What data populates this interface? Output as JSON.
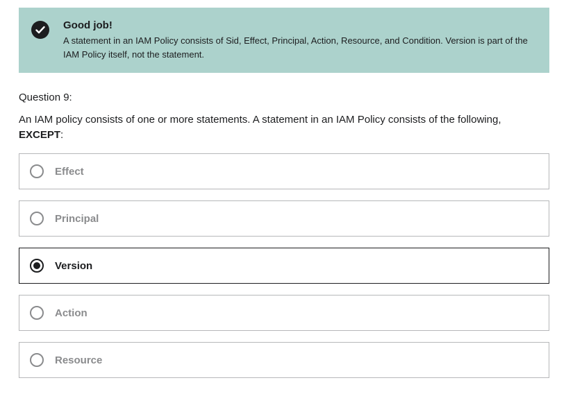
{
  "feedback": {
    "title": "Good job!",
    "body": "A statement in an IAM Policy consists of Sid, Effect, Principal, Action, Resource, and Condition. Version is part of the IAM Policy itself, not the statement."
  },
  "question": {
    "label": "Question 9:",
    "text": "An IAM policy consists of one or more statements. A statement in an IAM Policy consists of the following,",
    "emphasis": "EXCEPT",
    "suffix": ":"
  },
  "options": [
    {
      "label": "Effect",
      "selected": false
    },
    {
      "label": "Principal",
      "selected": false
    },
    {
      "label": "Version",
      "selected": true
    },
    {
      "label": "Action",
      "selected": false
    },
    {
      "label": "Resource",
      "selected": false
    }
  ]
}
